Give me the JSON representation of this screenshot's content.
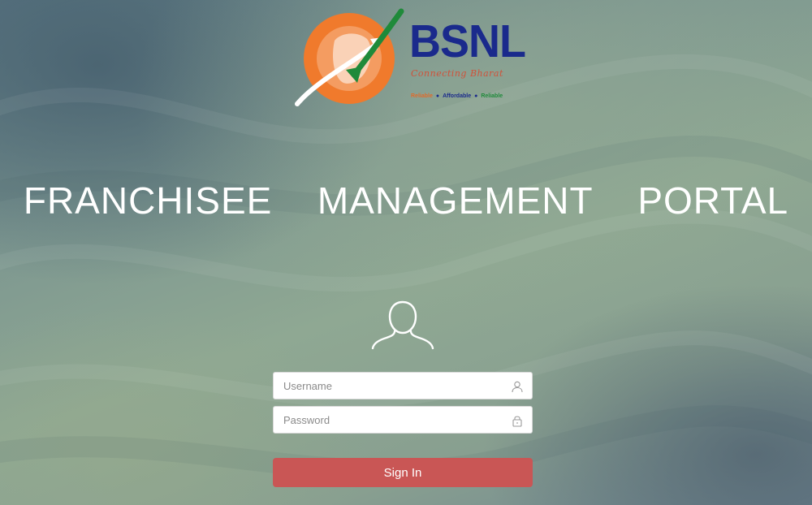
{
  "brand": {
    "name": "BSNL",
    "tagline": "Connecting Bharat",
    "values": [
      "Reliable",
      "Affordable",
      "Reliable"
    ],
    "colors": {
      "brand_blue": "#1a2a8c",
      "emblem_orange": "#f07a2c",
      "arrow_green": "#1f8a3a",
      "tagline_red": "#d0523a"
    }
  },
  "page": {
    "title": "FRANCHISEE  MANAGEMENT  PORTAL"
  },
  "login": {
    "avatar_icon": "user-outline-icon",
    "username": {
      "placeholder": "Username",
      "value": "",
      "icon": "user-icon"
    },
    "password": {
      "placeholder": "Password",
      "value": "",
      "icon": "lock-icon"
    },
    "submit_label": "Sign In",
    "submit_color": "#c95655"
  }
}
